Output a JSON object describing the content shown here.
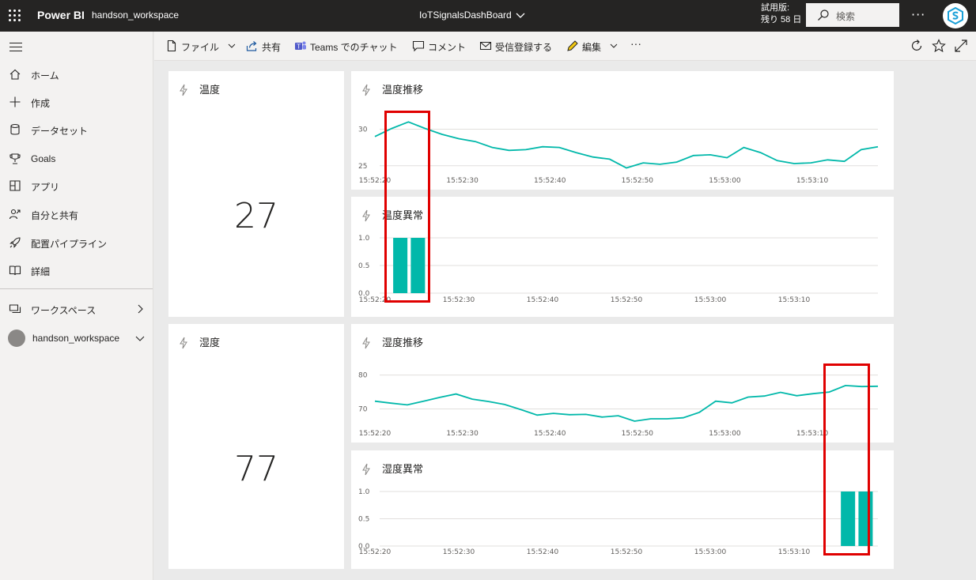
{
  "app": {
    "brand": "Power BI",
    "workspace": "handson_workspace",
    "dashboard_title": "IoTSignalsDashBoard",
    "trial_line1": "試用版:",
    "trial_line2": "残り 58 日",
    "search_placeholder": "検索"
  },
  "nav": {
    "items": [
      {
        "label": "ホーム",
        "icon": "home-icon"
      },
      {
        "label": "作成",
        "icon": "plus-icon"
      },
      {
        "label": "データセット",
        "icon": "database-icon"
      },
      {
        "label": "Goals",
        "icon": "trophy-icon"
      },
      {
        "label": "アプリ",
        "icon": "apps-icon"
      },
      {
        "label": "自分と共有",
        "icon": "shared-icon"
      },
      {
        "label": "配置パイプライン",
        "icon": "rocket-icon"
      },
      {
        "label": "詳細",
        "icon": "book-icon"
      }
    ],
    "workspaces_label": "ワークスペース",
    "current_workspace": "handson_workspace"
  },
  "actions": {
    "file": "ファイル",
    "share": "共有",
    "teams": "Teams でのチャット",
    "comment": "コメント",
    "subscribe": "受信登録する",
    "edit": "編集"
  },
  "colors": {
    "accent": "#01b8aa",
    "highlight": "#e00000",
    "topbar": "#252423"
  },
  "tiles": {
    "card1": {
      "title": "温度",
      "value": "27"
    },
    "card2": {
      "title": "湿度",
      "value": "77"
    },
    "line1": {
      "title": "温度推移"
    },
    "bar1": {
      "title": "温度異常"
    },
    "line2": {
      "title": "湿度推移"
    },
    "bar2": {
      "title": "湿度異常"
    }
  },
  "chart_data": [
    {
      "type": "line",
      "title": "温度推移",
      "x_ticks": [
        "15:52:20",
        "15:52:30",
        "15:52:40",
        "15:52:50",
        "15:53:00",
        "15:53:10"
      ],
      "y_ticks": [
        25,
        30
      ],
      "ylim": [
        24,
        32
      ],
      "x_start": 0,
      "x_end": 57.5,
      "x_tick_values": [
        0,
        10,
        20,
        30,
        40,
        50
      ],
      "values": [
        29.0,
        30.1,
        31.0,
        30.1,
        29.3,
        28.7,
        28.3,
        27.5,
        27.1,
        27.2,
        27.6,
        27.5,
        26.8,
        26.2,
        25.9,
        24.7,
        25.4,
        25.2,
        25.5,
        26.4,
        26.5,
        26.1,
        27.5,
        26.8,
        25.7,
        25.3,
        25.4,
        25.8,
        25.6,
        27.2,
        27.6
      ]
    },
    {
      "type": "bar",
      "title": "温度異常",
      "x_ticks": [
        "15:52:20",
        "15:52:30",
        "15:52:40",
        "15:52:50",
        "15:53:00",
        "15:53:10"
      ],
      "y_ticks": [
        "0.0",
        "0.5",
        "1.0"
      ],
      "ylim": [
        0,
        1
      ],
      "x_start": 0,
      "x_end": 60,
      "x_tick_values": [
        0,
        10,
        20,
        30,
        40,
        50
      ],
      "bars": [
        {
          "x": 0.2,
          "value": 1
        },
        {
          "x": 2.3,
          "value": 1
        }
      ]
    },
    {
      "type": "line",
      "title": "湿度推移",
      "x_ticks": [
        "15:52:20",
        "15:52:30",
        "15:52:40",
        "15:52:50",
        "15:53:00",
        "15:53:10"
      ],
      "y_ticks": [
        70,
        80
      ],
      "ylim": [
        65,
        82
      ],
      "x_start": 0,
      "x_end": 57.5,
      "x_tick_values": [
        0,
        10,
        20,
        30,
        40,
        50
      ],
      "values": [
        72.3,
        71.7,
        71.2,
        72.3,
        73.4,
        74.4,
        72.9,
        72.2,
        71.3,
        69.8,
        68.2,
        68.7,
        68.3,
        68.4,
        67.6,
        68.0,
        66.4,
        67.1,
        67.1,
        67.4,
        69.0,
        72.3,
        71.8,
        73.5,
        73.8,
        74.9,
        73.9,
        74.5,
        75.0,
        76.9,
        76.6,
        76.7
      ]
    },
    {
      "type": "bar",
      "title": "湿度異常",
      "x_ticks": [
        "15:52:20",
        "15:52:30",
        "15:52:40",
        "15:52:50",
        "15:53:00",
        "15:53:10"
      ],
      "y_ticks": [
        "0.0",
        "0.5",
        "1.0"
      ],
      "ylim": [
        0,
        1
      ],
      "x_start": 0,
      "x_end": 60,
      "x_tick_values": [
        0,
        10,
        20,
        30,
        40,
        50
      ],
      "bars": [
        {
          "x": 53.6,
          "value": 1
        },
        {
          "x": 55.7,
          "value": 1
        }
      ]
    }
  ]
}
